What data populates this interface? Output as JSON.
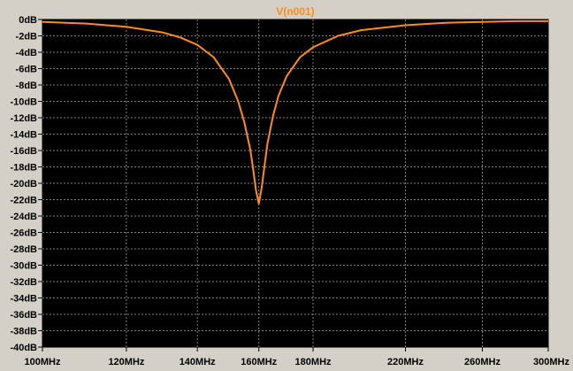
{
  "chart_data": {
    "type": "line",
    "title": "V(n001)",
    "xlabel": "",
    "ylabel": "",
    "x_scale": "log",
    "xlim": [
      100,
      300
    ],
    "ylim": [
      -40,
      0
    ],
    "x_ticks": [
      {
        "value": 100,
        "label": "100MHz"
      },
      {
        "value": 120,
        "label": "120MHz"
      },
      {
        "value": 140,
        "label": "140MHz"
      },
      {
        "value": 160,
        "label": "160MHz"
      },
      {
        "value": 180,
        "label": "180MHz"
      },
      {
        "value": 220,
        "label": "220MHz"
      },
      {
        "value": 260,
        "label": "260MHz"
      },
      {
        "value": 300,
        "label": "300MHz"
      }
    ],
    "y_ticks": [
      {
        "value": 0,
        "label": "0dB"
      },
      {
        "value": -2,
        "label": "-2dB"
      },
      {
        "value": -4,
        "label": "-4dB"
      },
      {
        "value": -6,
        "label": "-6dB"
      },
      {
        "value": -8,
        "label": "-8dB"
      },
      {
        "value": -10,
        "label": "-10dB"
      },
      {
        "value": -12,
        "label": "-12dB"
      },
      {
        "value": -14,
        "label": "-14dB"
      },
      {
        "value": -16,
        "label": "-16dB"
      },
      {
        "value": -18,
        "label": "-18dB"
      },
      {
        "value": -20,
        "label": "-20dB"
      },
      {
        "value": -22,
        "label": "-22dB"
      },
      {
        "value": -24,
        "label": "-24dB"
      },
      {
        "value": -26,
        "label": "-26dB"
      },
      {
        "value": -28,
        "label": "-28dB"
      },
      {
        "value": -30,
        "label": "-30dB"
      },
      {
        "value": -32,
        "label": "-32dB"
      },
      {
        "value": -34,
        "label": "-34dB"
      },
      {
        "value": -36,
        "label": "-36dB"
      },
      {
        "value": -38,
        "label": "-38dB"
      },
      {
        "value": -40,
        "label": "-40dB"
      }
    ],
    "grid": true,
    "series": [
      {
        "name": "V(n001)",
        "color": "#ff8c1a",
        "x": [
          100,
          110,
          120,
          130,
          135,
          140,
          145,
          150,
          153,
          155,
          157,
          158,
          159,
          160,
          161,
          162,
          163,
          165,
          167,
          170,
          175,
          180,
          190,
          200,
          220,
          240,
          260,
          280,
          300
        ],
        "y": [
          -0.3,
          -0.5,
          -0.9,
          -1.6,
          -2.2,
          -3.1,
          -4.6,
          -7.3,
          -10.0,
          -12.5,
          -15.8,
          -18.2,
          -20.8,
          -22.5,
          -20.5,
          -17.8,
          -15.2,
          -11.8,
          -9.3,
          -6.9,
          -4.6,
          -3.4,
          -2.0,
          -1.3,
          -0.7,
          -0.4,
          -0.3,
          -0.2,
          -0.2
        ]
      }
    ]
  },
  "colors": {
    "window_bg": "#d4d0c8",
    "plot_bg": "#000000",
    "grid": "#808080",
    "trace": "#ff8c1a"
  }
}
